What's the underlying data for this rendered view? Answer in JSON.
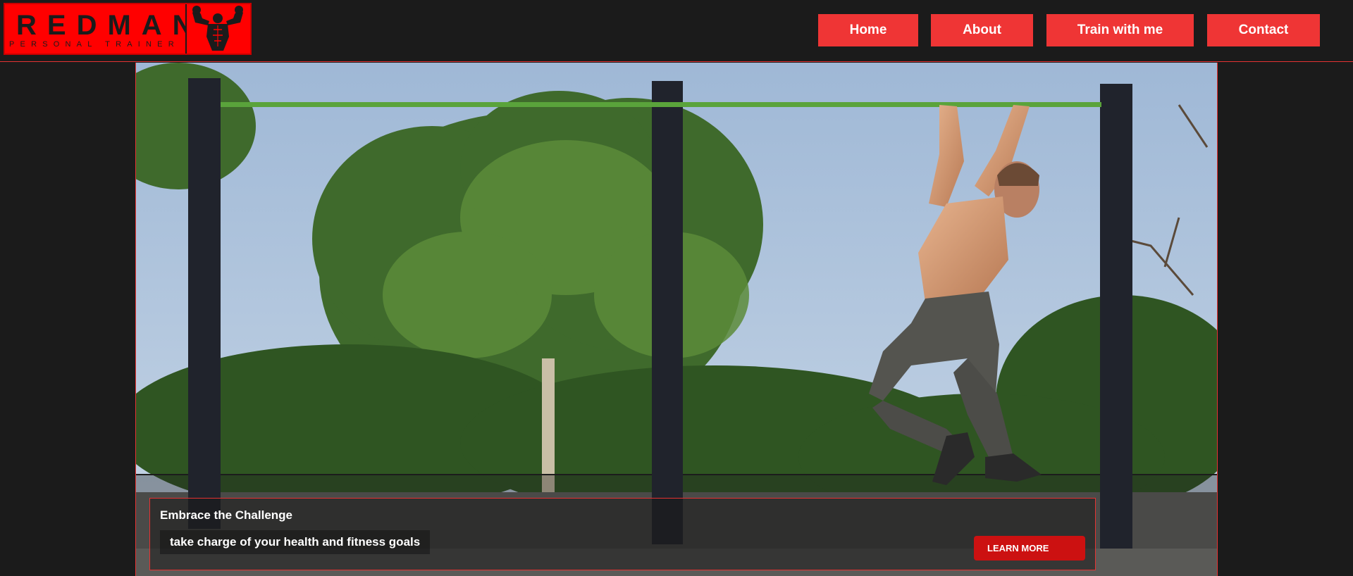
{
  "brand": {
    "name": "REDMAN",
    "tagline": "PERSONAL TRAINER",
    "logo_icon": "flexing-muscles-icon",
    "colors": {
      "accent": "#ef3535",
      "logo_red": "#ff0000",
      "background": "#1b1b1b",
      "button": "#cc1111"
    }
  },
  "nav": {
    "items": [
      {
        "label": "Home"
      },
      {
        "label": "About"
      },
      {
        "label": "Train with me"
      },
      {
        "label": "Contact"
      }
    ]
  },
  "hero": {
    "image": "man-doing-pull-up-on-outdoor-bar-photo",
    "caption": {
      "title": "Embrace the Challenge",
      "subtitle": "take charge of your health and fitness goals",
      "button_label": "LEARN MORE"
    }
  }
}
